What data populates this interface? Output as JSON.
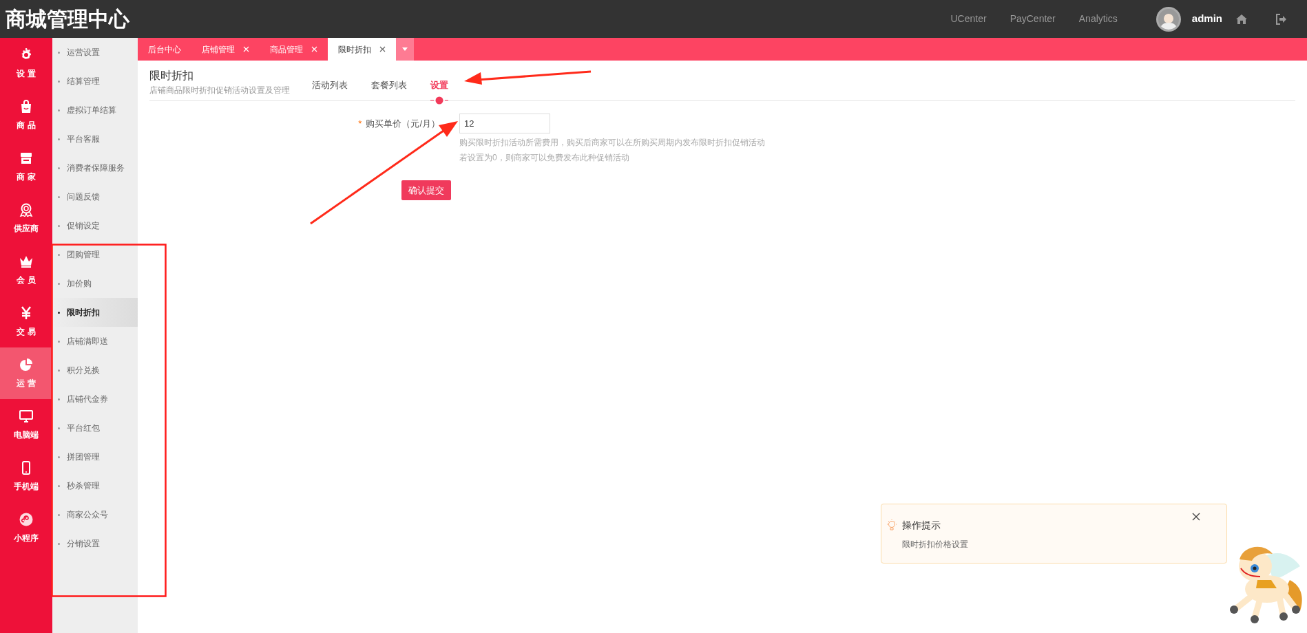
{
  "header": {
    "title": "商城管理中心",
    "links": [
      "UCenter",
      "PayCenter",
      "Analytics"
    ],
    "user": "admin"
  },
  "main_nav": [
    {
      "label": "设 置",
      "kind": "gear",
      "selected": false
    },
    {
      "label": "商 品",
      "kind": "bag",
      "selected": false
    },
    {
      "label": "商 家",
      "kind": "store",
      "selected": false
    },
    {
      "label": "供应商",
      "kind": "award",
      "selected": false
    },
    {
      "label": "会 员",
      "kind": "crown",
      "selected": false
    },
    {
      "label": "交 易",
      "kind": "yen",
      "selected": false
    },
    {
      "label": "运 营",
      "kind": "pie",
      "selected": true
    },
    {
      "label": "电脑端",
      "kind": "monitor",
      "selected": false
    },
    {
      "label": "手机端",
      "kind": "phone",
      "selected": false
    },
    {
      "label": "小程序",
      "kind": "link",
      "selected": false
    }
  ],
  "sub_nav": [
    {
      "label": "运营设置",
      "selected": false
    },
    {
      "label": "结算管理",
      "selected": false
    },
    {
      "label": "虚拟订单结算",
      "selected": false
    },
    {
      "label": "平台客服",
      "selected": false
    },
    {
      "label": "消费者保障服务",
      "selected": false
    },
    {
      "label": "问题反馈",
      "selected": false
    },
    {
      "label": "促销设定",
      "selected": false
    },
    {
      "label": "团购管理",
      "selected": false
    },
    {
      "label": "加价购",
      "selected": false
    },
    {
      "label": "限时折扣",
      "selected": true
    },
    {
      "label": "店铺满即送",
      "selected": false
    },
    {
      "label": "积分兑换",
      "selected": false
    },
    {
      "label": "店铺代金券",
      "selected": false
    },
    {
      "label": "平台红包",
      "selected": false
    },
    {
      "label": "拼团管理",
      "selected": false
    },
    {
      "label": "秒杀管理",
      "selected": false
    },
    {
      "label": "商家公众号",
      "selected": false
    },
    {
      "label": "分销设置",
      "selected": false
    }
  ],
  "page_tabs": [
    {
      "label": "后台中心",
      "closable": false,
      "selected": false
    },
    {
      "label": "店铺管理",
      "closable": true,
      "selected": false
    },
    {
      "label": "商品管理",
      "closable": true,
      "selected": false
    },
    {
      "label": "限时折扣",
      "closable": true,
      "selected": true
    }
  ],
  "page": {
    "title": "限时折扣",
    "subtitle": "店铺商品限时折扣促销活动设置及管理",
    "tabs": [
      {
        "label": "活动列表",
        "selected": false
      },
      {
        "label": "套餐列表",
        "selected": false
      },
      {
        "label": "设置",
        "selected": true
      }
    ]
  },
  "form": {
    "required_mark": "*",
    "label": "购买单价（元/月）",
    "value": "12",
    "help": [
      "购买限时折扣活动所需费用，购买后商家可以在所购买周期内发布限时折扣促销活动",
      "若设置为0，则商家可以免费发布此种促销活动"
    ],
    "submit": "确认提交"
  },
  "tip": {
    "title": "操作提示",
    "text": "限时折扣价格设置"
  }
}
